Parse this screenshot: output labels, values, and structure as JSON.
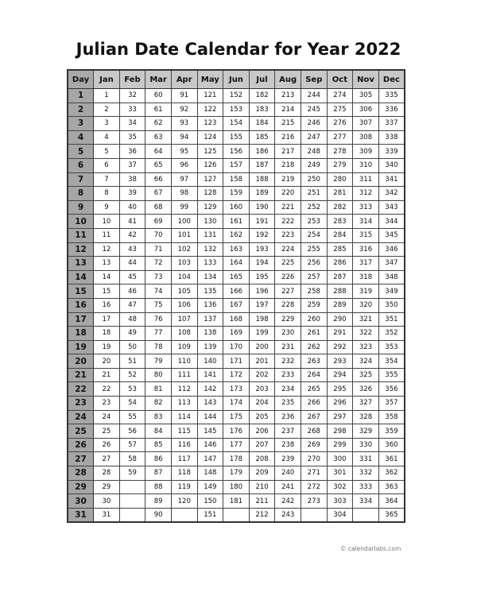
{
  "title": "Julian Date Calendar for Year 2022",
  "header": [
    "Day",
    "Jan",
    "Feb",
    "Mar",
    "Apr",
    "May",
    "Jun",
    "Jul",
    "Aug",
    "Sep",
    "Oct",
    "Nov",
    "Dec"
  ],
  "rows": [
    [
      1,
      1,
      32,
      60,
      91,
      121,
      152,
      182,
      213,
      244,
      274,
      305,
      335
    ],
    [
      2,
      2,
      33,
      61,
      92,
      122,
      153,
      183,
      214,
      245,
      275,
      306,
      336
    ],
    [
      3,
      3,
      34,
      62,
      93,
      123,
      154,
      184,
      215,
      246,
      276,
      307,
      337
    ],
    [
      4,
      4,
      35,
      63,
      94,
      124,
      155,
      185,
      216,
      247,
      277,
      308,
      338
    ],
    [
      5,
      5,
      36,
      64,
      95,
      125,
      156,
      186,
      217,
      248,
      278,
      309,
      339
    ],
    [
      6,
      6,
      37,
      65,
      96,
      126,
      157,
      187,
      218,
      249,
      279,
      310,
      340
    ],
    [
      7,
      7,
      38,
      66,
      97,
      127,
      158,
      188,
      219,
      250,
      280,
      311,
      341
    ],
    [
      8,
      8,
      39,
      67,
      98,
      128,
      159,
      189,
      220,
      251,
      281,
      312,
      342
    ],
    [
      9,
      9,
      40,
      68,
      99,
      129,
      160,
      190,
      221,
      252,
      282,
      313,
      343
    ],
    [
      10,
      10,
      41,
      69,
      100,
      130,
      161,
      191,
      222,
      253,
      283,
      314,
      344
    ],
    [
      11,
      11,
      42,
      70,
      101,
      131,
      162,
      192,
      223,
      254,
      284,
      315,
      345
    ],
    [
      12,
      12,
      43,
      71,
      102,
      132,
      163,
      193,
      224,
      255,
      285,
      316,
      346
    ],
    [
      13,
      13,
      44,
      72,
      103,
      133,
      164,
      194,
      225,
      256,
      286,
      317,
      347
    ],
    [
      14,
      14,
      45,
      73,
      104,
      134,
      165,
      195,
      226,
      257,
      287,
      318,
      348
    ],
    [
      15,
      15,
      46,
      74,
      105,
      135,
      166,
      196,
      227,
      258,
      288,
      319,
      349
    ],
    [
      16,
      16,
      47,
      75,
      106,
      136,
      167,
      197,
      228,
      259,
      289,
      320,
      350
    ],
    [
      17,
      17,
      48,
      76,
      107,
      137,
      168,
      198,
      229,
      260,
      290,
      321,
      351
    ],
    [
      18,
      18,
      49,
      77,
      108,
      138,
      169,
      199,
      230,
      261,
      291,
      322,
      352
    ],
    [
      19,
      19,
      50,
      78,
      109,
      139,
      170,
      200,
      231,
      262,
      292,
      323,
      353
    ],
    [
      20,
      20,
      51,
      79,
      110,
      140,
      171,
      201,
      232,
      263,
      293,
      324,
      354
    ],
    [
      21,
      21,
      52,
      80,
      111,
      141,
      172,
      202,
      233,
      264,
      294,
      325,
      355
    ],
    [
      22,
      22,
      53,
      81,
      112,
      142,
      173,
      203,
      234,
      265,
      295,
      326,
      356
    ],
    [
      23,
      23,
      54,
      82,
      113,
      143,
      174,
      204,
      235,
      266,
      296,
      327,
      357
    ],
    [
      24,
      24,
      55,
      83,
      114,
      144,
      175,
      205,
      236,
      267,
      297,
      328,
      358
    ],
    [
      25,
      25,
      56,
      84,
      115,
      145,
      176,
      206,
      237,
      268,
      298,
      329,
      359
    ],
    [
      26,
      26,
      57,
      85,
      116,
      146,
      177,
      207,
      238,
      269,
      299,
      330,
      360
    ],
    [
      27,
      27,
      58,
      86,
      117,
      147,
      178,
      208,
      239,
      270,
      300,
      331,
      361
    ],
    [
      28,
      28,
      59,
      87,
      118,
      148,
      179,
      209,
      240,
      271,
      301,
      332,
      362
    ],
    [
      29,
      29,
      null,
      88,
      119,
      149,
      180,
      210,
      241,
      272,
      302,
      333,
      363
    ],
    [
      30,
      30,
      null,
      89,
      120,
      150,
      181,
      211,
      242,
      273,
      303,
      334,
      364
    ],
    [
      31,
      31,
      null,
      90,
      null,
      151,
      null,
      212,
      243,
      null,
      304,
      null,
      365
    ]
  ],
  "footer": "© calendarlabs.com"
}
